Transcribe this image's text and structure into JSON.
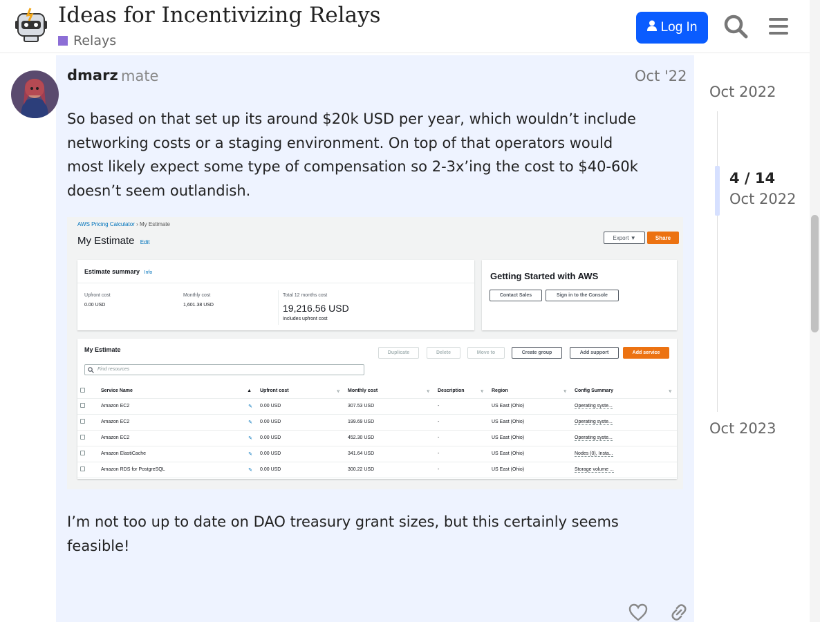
{
  "header": {
    "logo_icon": "robot-logo-icon",
    "title": "Ideas for Incentivizing Relays",
    "category": "Relays",
    "category_color": "#8c6ed6",
    "login_label": "Log In",
    "login_color": "#0a5cff"
  },
  "post": {
    "username": "dmarz",
    "user_title": "mate",
    "date": "Oct '22",
    "paragraph1": "So based on that set up its around $20k USD per year, which wouldn’t include networking costs or a staging environment. On top of that operators would most likely expect some type of compensation so 2-3x’ing the cost to $40-60k doesn’t seem outlandish.",
    "paragraph2": "I’m not too up to date on DAO treasury grant sizes, but this certainly seems feasible!",
    "background_color": "#eef3ff"
  },
  "aws": {
    "breadcrumb_root": "AWS Pricing Calculator",
    "breadcrumb_current": "My Estimate",
    "heading": "My Estimate",
    "edit_label": "Edit",
    "export_label": "Export ▼",
    "share_label": "Share",
    "summary_title": "Estimate summary",
    "summary_info": "Info",
    "upfront_label": "Upfront cost",
    "upfront_value": "0.00 USD",
    "monthly_label": "Monthly cost",
    "monthly_value": "1,601.38 USD",
    "total_label": "Total 12 months cost",
    "total_value": "19,216.56 USD",
    "total_note": "Includes upfront cost",
    "gs_title": "Getting Started with AWS",
    "contact_sales": "Contact Sales",
    "sign_in_console": "Sign in to the Console",
    "estimate_title": "My Estimate",
    "buttons": {
      "duplicate": "Duplicate",
      "delete": "Delete",
      "move_to": "Move to",
      "create_group": "Create group",
      "add_support": "Add support",
      "add_service": "Add service"
    },
    "find_placeholder": "Find resources",
    "columns": [
      "Service Name",
      "Upfront cost",
      "Monthly cost",
      "Description",
      "Region",
      "Config Summary"
    ],
    "rows": [
      {
        "service": "Amazon EC2",
        "upfront": "0.00 USD",
        "monthly": "307.53 USD",
        "description": "-",
        "region": "US East (Ohio)",
        "config": "Operating syste..."
      },
      {
        "service": "Amazon EC2",
        "upfront": "0.00 USD",
        "monthly": "199.69 USD",
        "description": "-",
        "region": "US East (Ohio)",
        "config": "Operating syste..."
      },
      {
        "service": "Amazon EC2",
        "upfront": "0.00 USD",
        "monthly": "452.30 USD",
        "description": "-",
        "region": "US East (Ohio)",
        "config": "Operating syste..."
      },
      {
        "service": "Amazon ElastiCache",
        "upfront": "0.00 USD",
        "monthly": "341.64 USD",
        "description": "-",
        "region": "US East (Ohio)",
        "config": "Nodes (0), Insta..."
      },
      {
        "service": "Amazon RDS for PostgreSQL",
        "upfront": "0.00 USD",
        "monthly": "300.22 USD",
        "description": "-",
        "region": "US East (Ohio)",
        "config": "Storage volume ..."
      }
    ]
  },
  "timeline": {
    "start": "Oct 2022",
    "position": "4 / 14",
    "current": "Oct 2022",
    "end": "Oct 2023"
  },
  "icons": {
    "search": "search-icon",
    "menu": "hamburger-menu-icon",
    "user": "user-icon",
    "heart": "heart-icon",
    "link": "link-icon"
  }
}
